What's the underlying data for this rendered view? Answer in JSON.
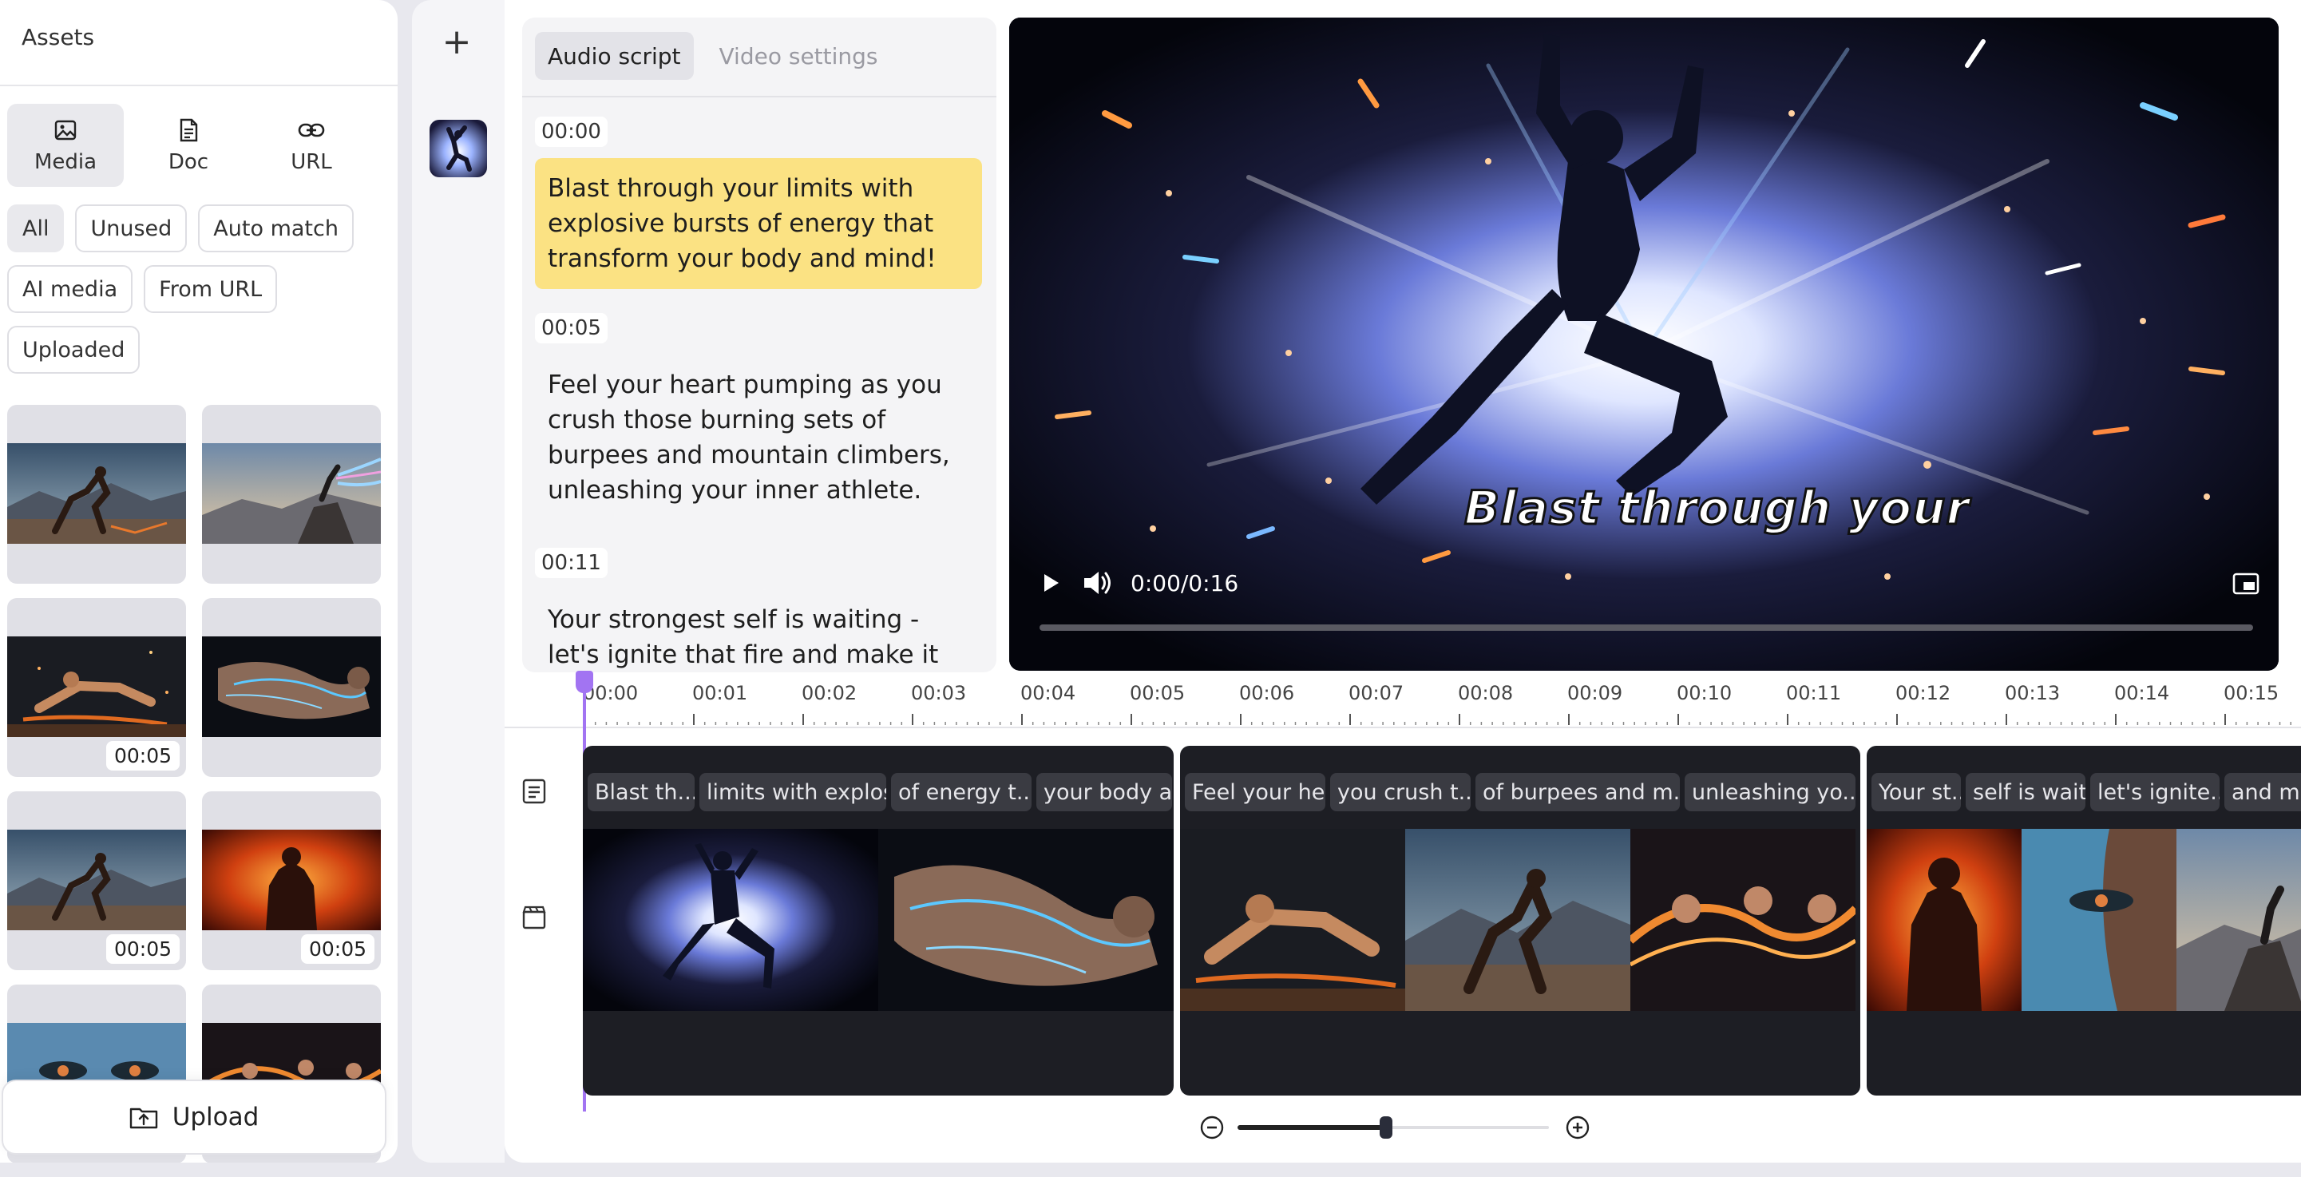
{
  "assets": {
    "title": "Assets",
    "type_tabs": [
      {
        "label": "Media",
        "icon": "image-icon",
        "active": true
      },
      {
        "label": "Doc",
        "icon": "document-icon",
        "active": false
      },
      {
        "label": "URL",
        "icon": "link-icon",
        "active": false
      }
    ],
    "filters": [
      "All",
      "Unused",
      "Auto match",
      "AI media",
      "From URL",
      "Uploaded"
    ],
    "cards": [
      {
        "scene": "runner-mountain",
        "duration": ""
      },
      {
        "scene": "climber-energy",
        "duration": ""
      },
      {
        "scene": "pushup-sparks",
        "duration": "00:05"
      },
      {
        "scene": "arm-lightning",
        "duration": ""
      },
      {
        "scene": "runner-mountain",
        "duration": "00:05"
      },
      {
        "scene": "fire-man",
        "duration": "00:05"
      },
      {
        "scene": "blue-eyes",
        "duration": ""
      },
      {
        "scene": "group-flame",
        "duration": ""
      }
    ],
    "upload_label": "Upload"
  },
  "rail": {
    "add_label": "+"
  },
  "script": {
    "tabs": [
      "Audio script",
      "Video settings"
    ],
    "segments": [
      {
        "time": "00:00",
        "text": "Blast through your limits with explosive bursts of energy that transform your body and mind!",
        "highlighted": true
      },
      {
        "time": "00:05",
        "text": "Feel your heart pumping as you crush those burning sets of burpees and mountain climbers, unleashing your inner athlete.",
        "highlighted": false
      },
      {
        "time": "00:11",
        "text": "Your strongest self is waiting - let's ignite that fire and make it happen!",
        "highlighted": false
      }
    ]
  },
  "player": {
    "caption": "Blast through your",
    "time": "0:00/0:16",
    "progress": 0
  },
  "timeline": {
    "ticks": [
      "00:00",
      "00:01",
      "00:02",
      "00:03",
      "00:04",
      "00:05",
      "00:06",
      "00:07",
      "00:08",
      "00:09",
      "00:10",
      "00:11",
      "00:12",
      "00:13",
      "00:14",
      "00:15"
    ],
    "clips": [
      {
        "words": [
          "Blast th...",
          "limits with explos...",
          "of energy t...",
          "your body a..."
        ]
      },
      {
        "words": [
          "Feel your he...",
          "you crush t...",
          "of burpees and m...",
          "unleashing yo..."
        ]
      },
      {
        "words": [
          "Your st...",
          "self is wait...",
          "let's ignite...",
          "and mak"
        ]
      }
    ]
  },
  "zoom": {
    "level": 0.45
  },
  "colors": {
    "accent": "#a274f2",
    "highlight": "#fbe283"
  }
}
